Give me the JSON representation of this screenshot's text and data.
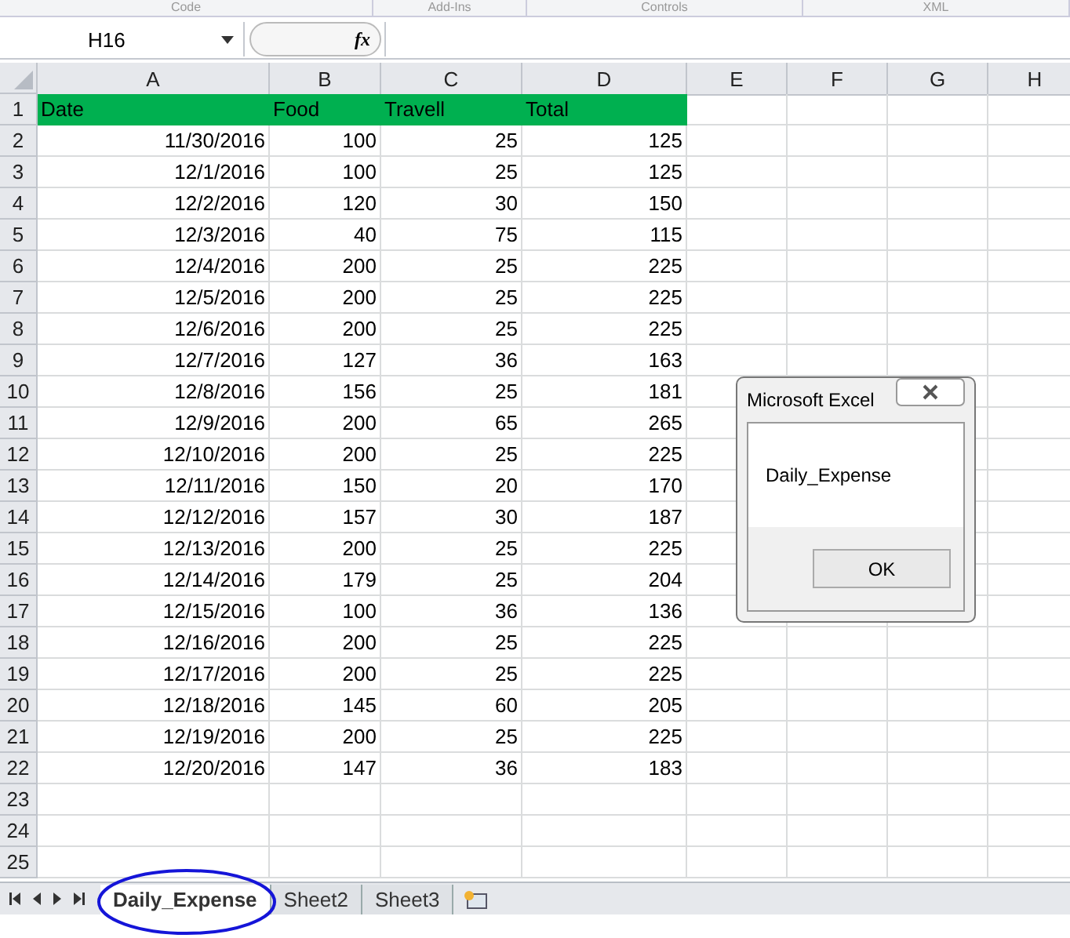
{
  "ribbon_groups": [
    "Code",
    "Add-Ins",
    "Controls",
    "XML"
  ],
  "formula_bar": {
    "name_box": "H16",
    "fx": "fx"
  },
  "columns": [
    "A",
    "B",
    "C",
    "D",
    "E",
    "F",
    "G",
    "H"
  ],
  "header_row": {
    "number": "1",
    "cells": [
      "Date",
      "Food",
      "Travell",
      "Total"
    ]
  },
  "rows": [
    {
      "number": "2",
      "cells": [
        "11/30/2016",
        "100",
        "25",
        "125"
      ]
    },
    {
      "number": "3",
      "cells": [
        "12/1/2016",
        "100",
        "25",
        "125"
      ]
    },
    {
      "number": "4",
      "cells": [
        "12/2/2016",
        "120",
        "30",
        "150"
      ]
    },
    {
      "number": "5",
      "cells": [
        "12/3/2016",
        "40",
        "75",
        "115"
      ]
    },
    {
      "number": "6",
      "cells": [
        "12/4/2016",
        "200",
        "25",
        "225"
      ]
    },
    {
      "number": "7",
      "cells": [
        "12/5/2016",
        "200",
        "25",
        "225"
      ]
    },
    {
      "number": "8",
      "cells": [
        "12/6/2016",
        "200",
        "25",
        "225"
      ]
    },
    {
      "number": "9",
      "cells": [
        "12/7/2016",
        "127",
        "36",
        "163"
      ]
    },
    {
      "number": "10",
      "cells": [
        "12/8/2016",
        "156",
        "25",
        "181"
      ]
    },
    {
      "number": "11",
      "cells": [
        "12/9/2016",
        "200",
        "65",
        "265"
      ]
    },
    {
      "number": "12",
      "cells": [
        "12/10/2016",
        "200",
        "25",
        "225"
      ]
    },
    {
      "number": "13",
      "cells": [
        "12/11/2016",
        "150",
        "20",
        "170"
      ]
    },
    {
      "number": "14",
      "cells": [
        "12/12/2016",
        "157",
        "30",
        "187"
      ]
    },
    {
      "number": "15",
      "cells": [
        "12/13/2016",
        "200",
        "25",
        "225"
      ]
    },
    {
      "number": "16",
      "cells": [
        "12/14/2016",
        "179",
        "25",
        "204"
      ]
    },
    {
      "number": "17",
      "cells": [
        "12/15/2016",
        "100",
        "36",
        "136"
      ]
    },
    {
      "number": "18",
      "cells": [
        "12/16/2016",
        "200",
        "25",
        "225"
      ]
    },
    {
      "number": "19",
      "cells": [
        "12/17/2016",
        "200",
        "25",
        "225"
      ]
    },
    {
      "number": "20",
      "cells": [
        "12/18/2016",
        "145",
        "60",
        "205"
      ]
    },
    {
      "number": "21",
      "cells": [
        "12/19/2016",
        "200",
        "25",
        "225"
      ]
    },
    {
      "number": "22",
      "cells": [
        "12/20/2016",
        "147",
        "36",
        "183"
      ]
    },
    {
      "number": "23",
      "cells": []
    },
    {
      "number": "24",
      "cells": []
    },
    {
      "number": "25",
      "cells": []
    }
  ],
  "sheet_tabs": [
    {
      "label": "Daily_Expense",
      "selected": true
    },
    {
      "label": "Sheet2",
      "selected": false
    },
    {
      "label": "Sheet3",
      "selected": false
    }
  ],
  "dialog": {
    "title": "Microsoft Excel",
    "message": "Daily_Expense",
    "button": "OK"
  }
}
